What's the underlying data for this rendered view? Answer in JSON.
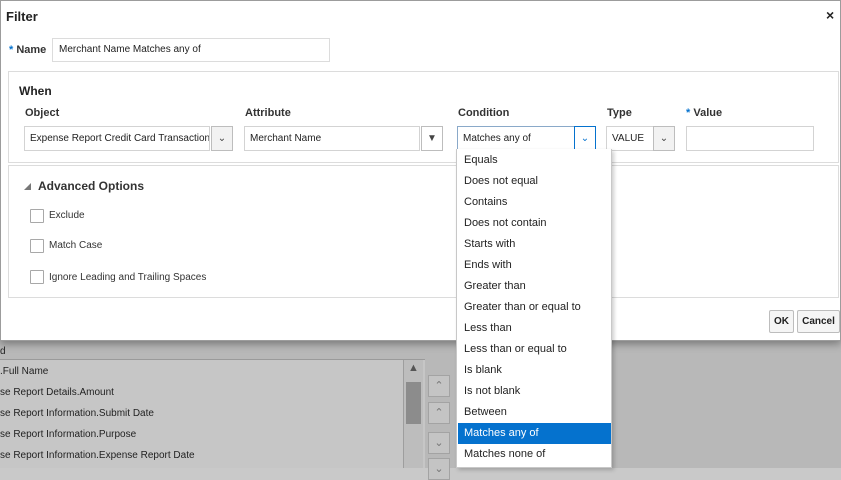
{
  "dialog": {
    "title": "Filter",
    "close_glyph": "×",
    "name_label": "Name",
    "name_value": "Merchant Name Matches any of",
    "required_marker": "*",
    "when_title": "When",
    "columns": {
      "object": "Object",
      "attribute": "Attribute",
      "condition": "Condition",
      "type": "Type",
      "value": "Value"
    },
    "fields": {
      "object": "Expense Report Credit Card Transaction",
      "attribute": "Merchant Name",
      "condition": "Matches any of",
      "type": "VALUE",
      "value": ""
    },
    "advanced_options_title": "Advanced Options",
    "checkboxes": [
      "Exclude",
      "Match Case",
      "Ignore Leading and Trailing Spaces"
    ],
    "ok_label": "OK",
    "cancel_label": "Cancel"
  },
  "condition_options": [
    "Equals",
    "Does not equal",
    "Contains",
    "Does not contain",
    "Starts with",
    "Ends with",
    "Greater than",
    "Greater than or equal to",
    "Less than",
    "Less than or equal to",
    "Is blank",
    "Is not blank",
    "Between",
    "Matches any of",
    "Matches none of"
  ],
  "selected_condition": "Matches any of",
  "background": {
    "column_label": "d",
    "list_items": [
      ".Full Name",
      "se Report Details.Amount",
      "se Report Information.Submit Date",
      "se Report Information.Purpose",
      "se Report Information.Expense Report Date"
    ]
  },
  "colors": {
    "accent": "#0572ce",
    "required": "#0572ce"
  }
}
